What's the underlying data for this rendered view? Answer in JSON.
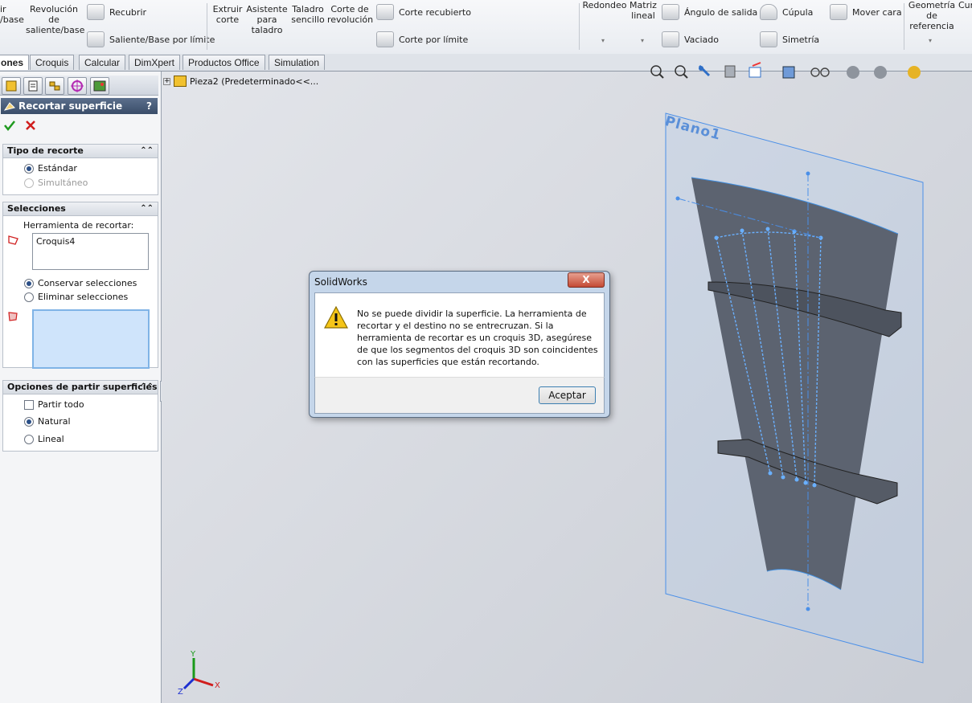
{
  "ribbon": {
    "col0": "ir\n/base",
    "revolucion": "Revolución\nde\nsaliente/base",
    "recubrir": "Recubrir",
    "saliente_limite": "Saliente/Base por límite",
    "extruir_corte": "Extruir\ncorte",
    "asistente": "Asistente\npara\ntaladro",
    "taladro": "Taladro\nsencillo",
    "corte_revolucion": "Corte de\nrevolución",
    "corte_recubierto": "Corte recubierto",
    "corte_limite": "Corte por límite",
    "redondeo": "Redondeo",
    "matriz": "Matriz\nlineal",
    "angulo": "Ángulo de salida",
    "cupula": "Cúpula",
    "mover_cara": "Mover cara",
    "vaciado": "Vaciado",
    "simetria": "Simetría",
    "geometria": "Geometría\nde\nreferencia",
    "cur": "Cur"
  },
  "tabs": [
    "ones",
    "Croquis",
    "Calcular",
    "DimXpert",
    "Productos Office",
    "Simulation"
  ],
  "tree": {
    "item": "Pieza2  (Predeterminado<<..."
  },
  "feature": {
    "title": "Recortar superficie",
    "help": "?",
    "tipo": {
      "header": "Tipo de recorte",
      "estandar": "Estándar",
      "simultaneo": "Simultáneo"
    },
    "selecciones": {
      "header": "Selecciones",
      "herramienta_label": "Herramienta de recortar:",
      "herramienta_value": "Croquis4",
      "conservar": "Conservar selecciones",
      "eliminar": "Eliminar selecciones"
    },
    "opciones": {
      "header": "Opciones de partir superficies",
      "partir_todo": "Partir todo",
      "natural": "Natural",
      "lineal": "Lineal"
    }
  },
  "viewport": {
    "plane_label": "Plano1"
  },
  "axes": {
    "x": "X",
    "y": "Y",
    "z": "Z"
  },
  "dialog": {
    "title": "SolidWorks",
    "close": "X",
    "message": "No se puede dividir la superficie. La herramienta de recortar y el destino no se entrecruzan. Si la herramienta de recortar es un croquis 3D, asegúrese de que los segmentos del croquis 3D son coincidentes con las superficies que están recortando.",
    "ok": "Aceptar"
  },
  "colors": {
    "accent": "#3c7fb1",
    "sketch": "#4a8fe8",
    "surface": "#5c6370"
  }
}
